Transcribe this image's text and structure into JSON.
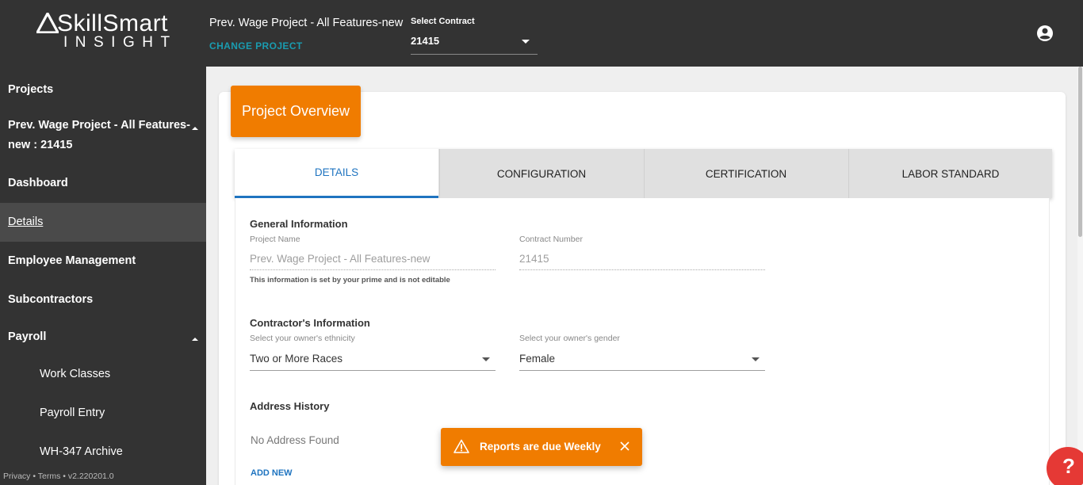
{
  "brand": {
    "line1": "SkillSmart",
    "line2": "INSIGHT"
  },
  "header": {
    "project_name": "Prev. Wage Project - All Features-new",
    "change_project": "CHANGE PROJECT",
    "contract_label": "Select Contract",
    "contract_value": "21415"
  },
  "sidebar": {
    "projects": "Projects",
    "project_line1": "Prev. Wage Project - All Features-",
    "project_line2": "new : 21415",
    "dashboard": "Dashboard",
    "details": "Details",
    "employee_management": "Employee Management",
    "subcontractors": "Subcontractors",
    "payroll": "Payroll",
    "work_classes": "Work Classes",
    "payroll_entry": "Payroll Entry",
    "wh347_archive": "WH-347 Archive",
    "footer": "Privacy • Terms • v2.220201.0"
  },
  "overview": {
    "title": "Project Overview"
  },
  "tabs": [
    "DETAILS",
    "CONFIGURATION",
    "CERTIFICATION",
    "LABOR STANDARD"
  ],
  "general": {
    "title": "General Information",
    "project_name_label": "Project Name",
    "project_name_value": "Prev. Wage Project - All Features-new",
    "contract_number_label": "Contract Number",
    "contract_number_value": "21415",
    "note": "This information is set by your prime and is not editable"
  },
  "contractor": {
    "title": "Contractor's Information",
    "ethnicity_label": "Select your owner's ethnicity",
    "ethnicity_value": "Two or More Races",
    "gender_label": "Select your owner's gender",
    "gender_value": "Female"
  },
  "address": {
    "title": "Address History",
    "empty": "No Address Found",
    "add_new": "ADD NEW"
  },
  "toast": {
    "message": "Reports are due Weekly"
  },
  "help": {
    "label": "?"
  },
  "colors": {
    "orange": "#f07c00",
    "blue": "#1f74c0",
    "teal": "#1a9cb0",
    "dark": "#333333",
    "help_red": "#e53935"
  }
}
